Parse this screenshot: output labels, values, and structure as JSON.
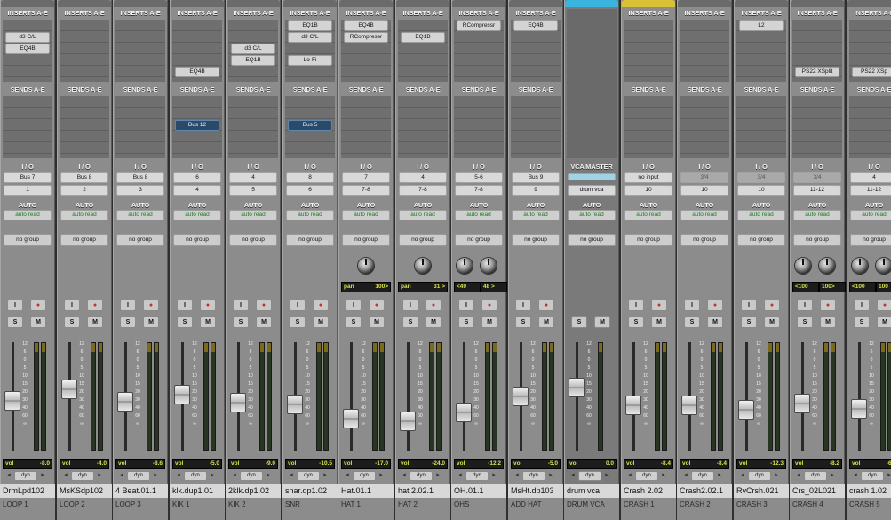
{
  "labels": {
    "inserts": "INSERTS A-E",
    "sends": "SENDS A-E",
    "io": "I / O",
    "auto": "AUTO",
    "vca_master": "VCA MASTER",
    "vol": "vol",
    "dyn": "dyn",
    "solo": "S",
    "mute": "M",
    "input": "I",
    "scale": [
      "12",
      "6",
      "0",
      "5",
      "10",
      "15",
      "20",
      "30",
      "40",
      "60",
      "∞"
    ]
  },
  "strips": [
    {
      "name": "DrmLpd102",
      "comment": "LOOP 1",
      "inserts": [
        "",
        "d3 C/L",
        "EQ4B",
        "",
        ""
      ],
      "sends": [
        "",
        "",
        "",
        "",
        ""
      ],
      "in": "Bus 7",
      "out": "1",
      "auto": "auto read",
      "group": "no group",
      "pan": [],
      "vol": "-8.0",
      "fader": 0.45
    },
    {
      "name": "MsKSdp102",
      "comment": "LOOP 2",
      "inserts": [
        "",
        "",
        "",
        "",
        ""
      ],
      "sends": [
        "",
        "",
        "",
        "",
        ""
      ],
      "in": "Bus 8",
      "out": "2",
      "auto": "auto read",
      "group": "no group",
      "pan": [],
      "vol": "-4.0",
      "fader": 0.58
    },
    {
      "name": "4 Beat.01.1",
      "comment": "LOOP 3",
      "inserts": [
        "",
        "",
        "",
        "",
        ""
      ],
      "sends": [
        "",
        "",
        "",
        "",
        ""
      ],
      "in": "Bus 8",
      "out": "3",
      "auto": "auto read",
      "group": "no group",
      "pan": [],
      "vol": "-8.6",
      "fader": 0.44
    },
    {
      "name": "klk.dup1.01",
      "comment": "KIK 1",
      "inserts": [
        "",
        "",
        "",
        "",
        "EQ4B"
      ],
      "sends": [
        "",
        "",
        "Bus 12",
        "",
        ""
      ],
      "in": "6",
      "out": "4",
      "auto": "auto read",
      "group": "no group",
      "pan": [],
      "vol": "-5.0",
      "fader": 0.52
    },
    {
      "name": "2klk.dp1.02",
      "comment": "KIK 2",
      "inserts": [
        "",
        "",
        "d3 C/L",
        "EQ1B",
        ""
      ],
      "sends": [
        "",
        "",
        "",
        "",
        ""
      ],
      "in": "4",
      "out": "5",
      "auto": "auto read",
      "group": "no group",
      "pan": [],
      "vol": "-9.0",
      "fader": 0.43
    },
    {
      "name": "snar.dp1.02",
      "comment": "SNR",
      "inserts": [
        "EQ1B",
        "d3 C/L",
        "",
        "Lo-Fi",
        ""
      ],
      "sends": [
        "",
        "",
        "Bus 5",
        "",
        ""
      ],
      "in": "8",
      "out": "6",
      "auto": "auto read",
      "group": "no group",
      "pan": [],
      "vol": "-10.5",
      "fader": 0.41
    },
    {
      "name": "Hat.01.1",
      "comment": "HAT 1",
      "inserts": [
        "EQ4B",
        "RCompressr",
        "",
        "",
        ""
      ],
      "sends": [
        "",
        "",
        "",
        "",
        ""
      ],
      "in": "7",
      "out": "7-8",
      "auto": "auto read",
      "group": "no group",
      "pan": [
        {
          "label": "pan",
          "value": "100>"
        }
      ],
      "vol": "-17.0",
      "fader": 0.25
    },
    {
      "name": "hat 2.02.1",
      "comment": "HAT 2",
      "inserts": [
        "",
        "EQ1B",
        "",
        "",
        ""
      ],
      "sends": [
        "",
        "",
        "",
        "",
        ""
      ],
      "in": "4",
      "out": "7-8",
      "auto": "auto read",
      "group": "no group",
      "pan": [
        {
          "label": "pan",
          "value": "31 >"
        }
      ],
      "vol": "-24.0",
      "fader": 0.22
    },
    {
      "name": "OH.01.1",
      "comment": "OHS",
      "inserts": [
        "RCompressr",
        "",
        "",
        "",
        ""
      ],
      "sends": [
        "",
        "",
        "",
        "",
        ""
      ],
      "in": "5-6",
      "out": "7-8",
      "auto": "auto read",
      "group": "no group",
      "pan": [
        {
          "label": "<49",
          "value": ""
        },
        {
          "label": "",
          "value": "48 >"
        }
      ],
      "vol": "-12.2",
      "fader": 0.32
    },
    {
      "name": "MsHt.dp103",
      "comment": "ADD HAT",
      "inserts": [
        "EQ4B",
        "",
        "",
        "",
        ""
      ],
      "sends": [
        "",
        "",
        "",
        "",
        ""
      ],
      "in": "Bus 9",
      "out": "9",
      "auto": "auto read",
      "group": "no group",
      "pan": [],
      "vol": "-5.0",
      "fader": 0.5
    },
    {
      "name": "drum vca",
      "comment": "DRUM VCA",
      "vca": true,
      "inserts": [],
      "sends": [],
      "in": "",
      "out": "drum vca",
      "auto": "auto read",
      "group": "no group",
      "pan": [],
      "vol": "0.0",
      "fader": 0.6,
      "color": "#3ab3dd"
    },
    {
      "name": "Crash 2.02",
      "comment": "CRASH 1",
      "inserts": [
        "",
        "",
        "",
        "",
        ""
      ],
      "sends": [
        "",
        "",
        "",
        "",
        ""
      ],
      "in": "no input",
      "out": "10",
      "auto": "auto read",
      "group": "no group",
      "pan": [],
      "vol": "-8.4",
      "fader": 0.4,
      "color": "#d9c236"
    },
    {
      "name": "Crash2.02.1",
      "comment": "CRASH 2",
      "inserts": [
        "",
        "",
        "",
        "",
        ""
      ],
      "sends": [
        "",
        "",
        "",
        "",
        ""
      ],
      "in": "3/4",
      "out": "10",
      "auto": "auto read",
      "group": "no group",
      "pan": [],
      "vol": "-8.4",
      "fader": 0.4
    },
    {
      "name": "RvCrsh.021",
      "comment": "CRASH 3",
      "inserts": [
        "L2",
        "",
        "",
        "",
        ""
      ],
      "sends": [
        "",
        "",
        "",
        "",
        ""
      ],
      "in": "3/4",
      "out": "10",
      "auto": "auto read",
      "group": "no group",
      "pan": [],
      "vol": "-12.3",
      "fader": 0.35
    },
    {
      "name": "Crs_02L021",
      "comment": "CRASH 4",
      "inserts": [
        "",
        "",
        "",
        "",
        "PS22 XSplit"
      ],
      "sends": [
        "",
        "",
        "",
        "",
        ""
      ],
      "in": "3/4",
      "out": "11-12",
      "auto": "auto read",
      "group": "no group",
      "pan": [
        {
          "label": "<100",
          "value": ""
        },
        {
          "label": "",
          "value": "100>"
        }
      ],
      "vol": "-8.2",
      "fader": 0.42
    },
    {
      "name": "crash 1.02",
      "comment": "CRASH 5",
      "inserts": [
        "",
        "",
        "",
        "",
        "PS22 XSp"
      ],
      "sends": [
        "",
        "",
        "",
        "",
        ""
      ],
      "in": "4",
      "out": "11-12",
      "auto": "auto read",
      "group": "no group",
      "pan": [
        {
          "label": "<100",
          "value": ""
        },
        {
          "label": "",
          "value": "100"
        }
      ],
      "vol": "-6.7",
      "fader": 0.36
    }
  ]
}
